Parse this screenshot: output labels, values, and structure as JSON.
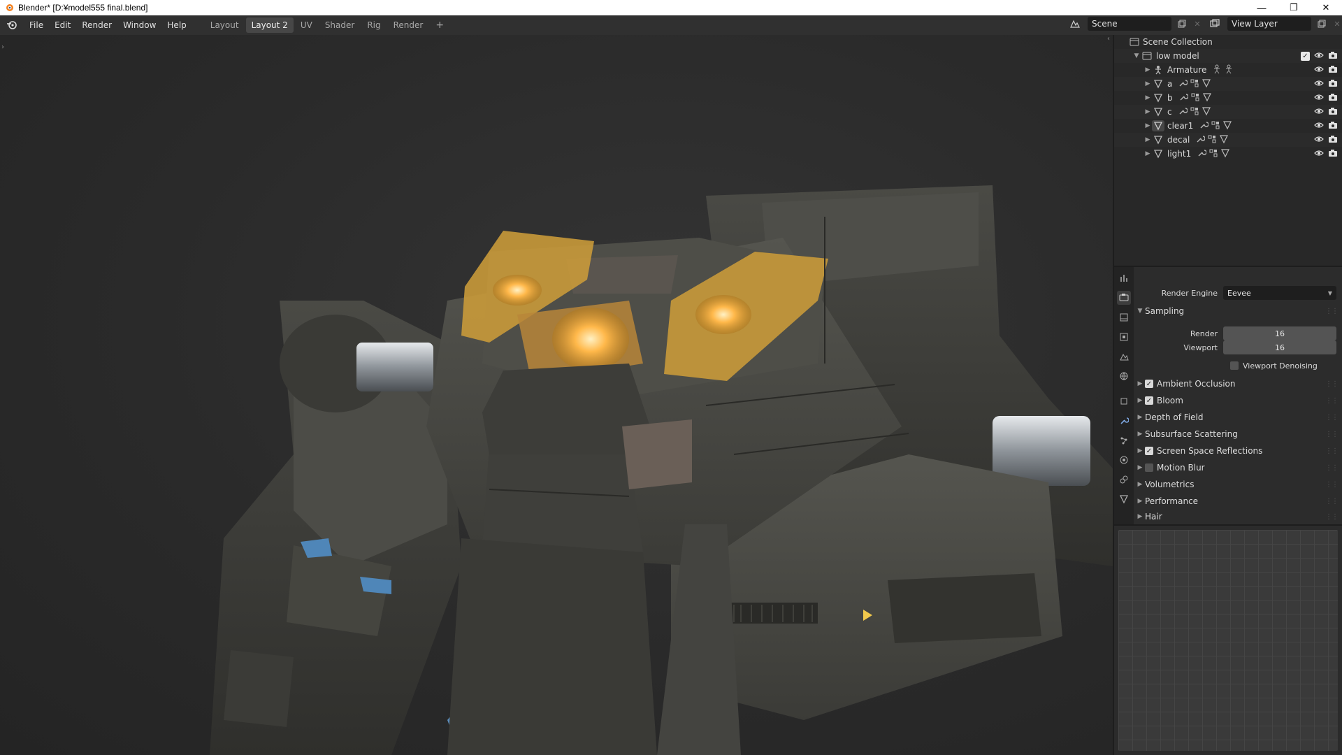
{
  "window": {
    "title": "Blender* [D:¥model555 final.blend]",
    "minimize_icon": "—",
    "maximize_icon": "❐",
    "close_icon": "✕"
  },
  "menu": {
    "items": [
      "File",
      "Edit",
      "Render",
      "Window",
      "Help"
    ]
  },
  "workspaces": {
    "tabs": [
      "Layout",
      "Layout 2",
      "UV",
      "Shader",
      "Rig",
      "Render"
    ],
    "active": "Layout 2",
    "add_label": "+"
  },
  "scene": {
    "scene_name": "Scene",
    "view_layer_name": "View Layer"
  },
  "outliner": {
    "root": "Scene Collection",
    "collection": "low model",
    "objects": [
      {
        "name": "Armature",
        "type": "armature"
      },
      {
        "name": "a",
        "type": "mesh"
      },
      {
        "name": "b",
        "type": "mesh"
      },
      {
        "name": "c",
        "type": "mesh"
      },
      {
        "name": "clear1",
        "type": "mesh"
      },
      {
        "name": "decal",
        "type": "mesh"
      },
      {
        "name": "light1",
        "type": "mesh"
      }
    ]
  },
  "render_props": {
    "render_engine_label": "Render Engine",
    "render_engine_value": "Eevee",
    "sampling_label": "Sampling",
    "render_label": "Render",
    "render_value": "16",
    "viewport_label": "Viewport",
    "viewport_value": "16",
    "viewport_denoising_label": "Viewport Denoising",
    "panels": [
      {
        "label": "Ambient Occlusion",
        "checkbox": true,
        "checked": true
      },
      {
        "label": "Bloom",
        "checkbox": true,
        "checked": true
      },
      {
        "label": "Depth of Field",
        "checkbox": false
      },
      {
        "label": "Subsurface Scattering",
        "checkbox": false
      },
      {
        "label": "Screen Space Reflections",
        "checkbox": true,
        "checked": true
      },
      {
        "label": "Motion Blur",
        "checkbox": true,
        "checked": false
      },
      {
        "label": "Volumetrics",
        "checkbox": false
      },
      {
        "label": "Performance",
        "checkbox": false
      },
      {
        "label": "Hair",
        "checkbox": false
      }
    ]
  },
  "colors": {
    "accent_glow": "#ffb84a",
    "mech_body": "#4a4a44",
    "blue_accent": "#4f86b8"
  }
}
